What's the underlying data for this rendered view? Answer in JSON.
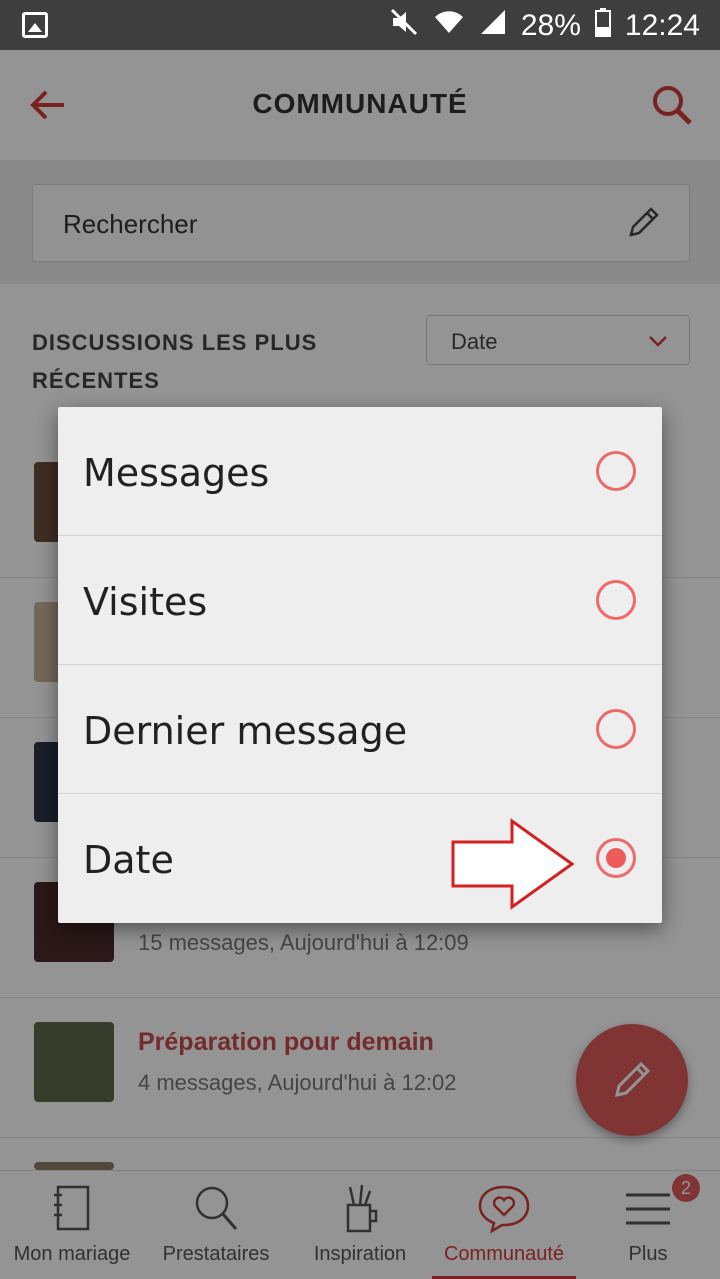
{
  "status_bar": {
    "battery": "28%",
    "time": "12:24"
  },
  "app_bar": {
    "title": "COMMUNAUTÉ"
  },
  "search": {
    "label": "Rechercher"
  },
  "section": {
    "heading": "DISCUSSIONS LES PLUS RÉCENTES",
    "sort_value": "Date"
  },
  "list": {
    "rows": [
      {
        "title": "",
        "meta": ""
      },
      {
        "title": "",
        "meta": ""
      },
      {
        "title": "",
        "meta": ""
      },
      {
        "title": "",
        "meta": "15 messages, Aujourd'hui à 12:09"
      },
      {
        "title": "Préparation pour demain",
        "meta": "4 messages, Aujourd'hui à 12:02"
      }
    ]
  },
  "dialog": {
    "options": [
      {
        "label": "Messages",
        "selected": false
      },
      {
        "label": "Visites",
        "selected": false
      },
      {
        "label": "Dernier message",
        "selected": false
      },
      {
        "label": "Date",
        "selected": true
      }
    ]
  },
  "bottom_nav": {
    "items": [
      {
        "label": "Mon mariage",
        "icon": "notebook-icon"
      },
      {
        "label": "Prestataires",
        "icon": "search-icon"
      },
      {
        "label": "Inspiration",
        "icon": "pencil-cup-icon"
      },
      {
        "label": "Communauté",
        "icon": "heart-chat-icon",
        "active": true
      },
      {
        "label": "Plus",
        "icon": "menu-icon"
      }
    ],
    "plus_badge": "2"
  },
  "colors": {
    "accent": "#d23c3c",
    "radio": "#ec6a6a",
    "overlay": "rgba(0,0,0,0.42)"
  }
}
